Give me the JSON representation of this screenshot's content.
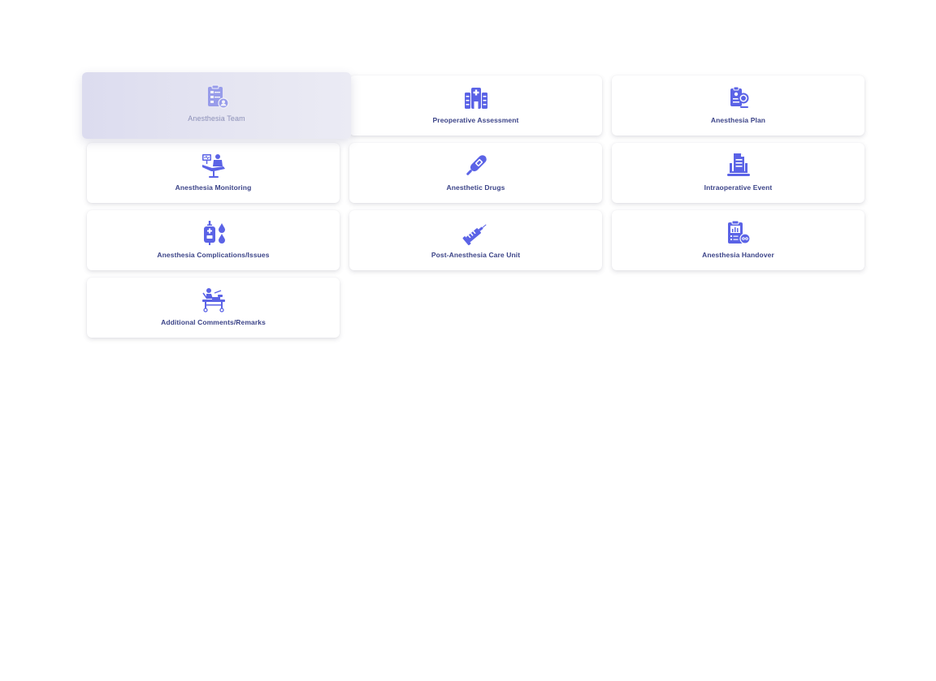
{
  "accent_color": "#5b63e6",
  "active_card_index": 0,
  "cards": [
    {
      "label": "Anesthesia Team",
      "icon": "clipboard-person-icon"
    },
    {
      "label": "Preoperative Assessment",
      "icon": "hospital-building-icon"
    },
    {
      "label": "Anesthesia Plan",
      "icon": "clipboard-search-icon"
    },
    {
      "label": "Anesthesia Monitoring",
      "icon": "patient-monitor-icon"
    },
    {
      "label": "Anesthetic Drugs",
      "icon": "thermometer-icon"
    },
    {
      "label": "Intraoperative Event",
      "icon": "laptop-document-icon"
    },
    {
      "label": "Anesthesia Complications/Issues",
      "icon": "iv-bag-drops-icon"
    },
    {
      "label": "Post-Anesthesia Care Unit",
      "icon": "syringe-icon"
    },
    {
      "label": "Anesthesia Handover",
      "icon": "clipboard-chart-icon"
    },
    {
      "label": "Additional Comments/Remarks",
      "icon": "stretcher-patient-icon"
    }
  ]
}
